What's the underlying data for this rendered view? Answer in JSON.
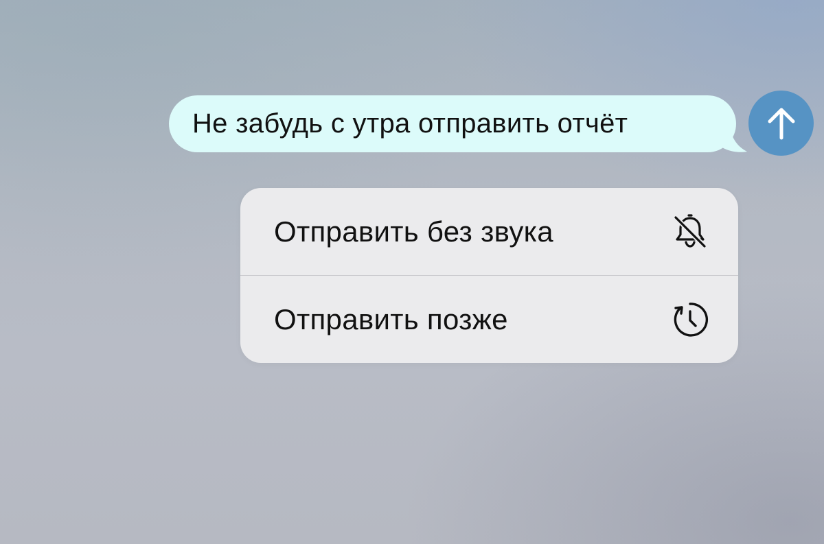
{
  "message": {
    "text": "Не забудь с утра отправить отчёт",
    "bubble_color": "#dcfbfa"
  },
  "send_button": {
    "icon": "arrow-up-icon",
    "color": "#5693c4"
  },
  "context_menu": {
    "items": [
      {
        "label": "Отправить без звука",
        "icon": "bell-slash-icon"
      },
      {
        "label": "Отправить позже",
        "icon": "clock-icon"
      }
    ],
    "background": "#ebebed"
  }
}
